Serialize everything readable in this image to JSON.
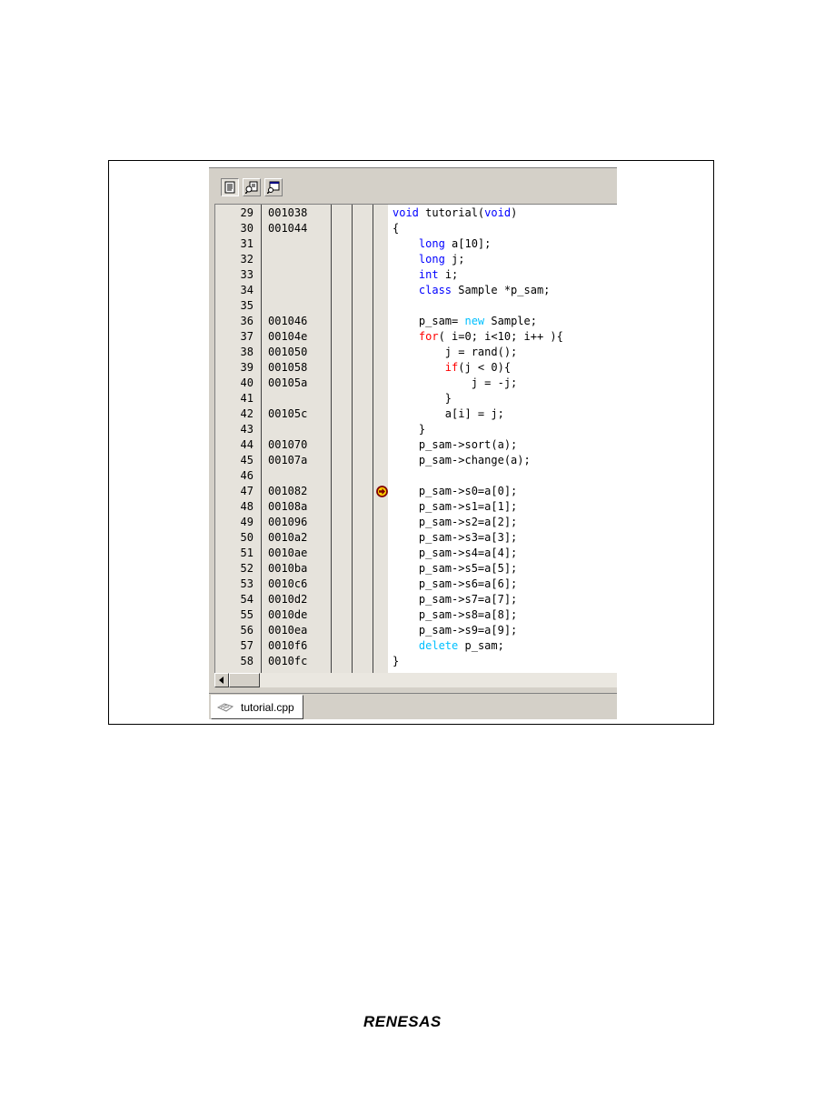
{
  "editor": {
    "toolbar": [
      {
        "icon": "source-view-icon"
      },
      {
        "icon": "mixed-view-icon"
      },
      {
        "icon": "disassembly-view-icon"
      }
    ],
    "lines": [
      {
        "num": "29",
        "addr": "001038",
        "code": [
          {
            "t": "void",
            "c": "kw"
          },
          {
            "t": " tutorial("
          },
          {
            "t": "void",
            "c": "kw"
          },
          {
            "t": ")"
          }
        ]
      },
      {
        "num": "30",
        "addr": "001044",
        "code": [
          {
            "t": "{"
          }
        ]
      },
      {
        "num": "31",
        "addr": "",
        "code": [
          {
            "t": "    "
          },
          {
            "t": "long",
            "c": "kw"
          },
          {
            "t": " a[10];"
          }
        ]
      },
      {
        "num": "32",
        "addr": "",
        "code": [
          {
            "t": "    "
          },
          {
            "t": "long",
            "c": "kw"
          },
          {
            "t": " j;"
          }
        ]
      },
      {
        "num": "33",
        "addr": "",
        "code": [
          {
            "t": "    "
          },
          {
            "t": "int",
            "c": "kw"
          },
          {
            "t": " i;"
          }
        ]
      },
      {
        "num": "34",
        "addr": "",
        "code": [
          {
            "t": "    "
          },
          {
            "t": "class",
            "c": "kw"
          },
          {
            "t": " Sample *p_sam;"
          }
        ]
      },
      {
        "num": "35",
        "addr": "",
        "code": []
      },
      {
        "num": "36",
        "addr": "001046",
        "code": [
          {
            "t": "    p_sam= "
          },
          {
            "t": "new",
            "c": "kc"
          },
          {
            "t": " Sample;"
          }
        ]
      },
      {
        "num": "37",
        "addr": "00104e",
        "code": [
          {
            "t": "    "
          },
          {
            "t": "for",
            "c": "kr"
          },
          {
            "t": "( i=0; i<10; i++ ){"
          }
        ]
      },
      {
        "num": "38",
        "addr": "001050",
        "code": [
          {
            "t": "        j = rand();"
          }
        ]
      },
      {
        "num": "39",
        "addr": "001058",
        "code": [
          {
            "t": "        "
          },
          {
            "t": "if",
            "c": "kr"
          },
          {
            "t": "(j < 0){"
          }
        ]
      },
      {
        "num": "40",
        "addr": "00105a",
        "code": [
          {
            "t": "            j = -j;"
          }
        ]
      },
      {
        "num": "41",
        "addr": "",
        "code": [
          {
            "t": "        }"
          }
        ]
      },
      {
        "num": "42",
        "addr": "00105c",
        "code": [
          {
            "t": "        a[i] = j;"
          }
        ]
      },
      {
        "num": "43",
        "addr": "",
        "code": [
          {
            "t": "    }"
          }
        ]
      },
      {
        "num": "44",
        "addr": "001070",
        "code": [
          {
            "t": "    p_sam->sort(a);"
          }
        ]
      },
      {
        "num": "45",
        "addr": "00107a",
        "code": [
          {
            "t": "    p_sam->change(a);"
          }
        ]
      },
      {
        "num": "46",
        "addr": "",
        "code": []
      },
      {
        "num": "47",
        "addr": "001082",
        "code": [
          {
            "t": "    p_sam->s0=a[0];"
          }
        ],
        "pc": true
      },
      {
        "num": "48",
        "addr": "00108a",
        "code": [
          {
            "t": "    p_sam->s1=a[1];"
          }
        ]
      },
      {
        "num": "49",
        "addr": "001096",
        "code": [
          {
            "t": "    p_sam->s2=a[2];"
          }
        ]
      },
      {
        "num": "50",
        "addr": "0010a2",
        "code": [
          {
            "t": "    p_sam->s3=a[3];"
          }
        ]
      },
      {
        "num": "51",
        "addr": "0010ae",
        "code": [
          {
            "t": "    p_sam->s4=a[4];"
          }
        ]
      },
      {
        "num": "52",
        "addr": "0010ba",
        "code": [
          {
            "t": "    p_sam->s5=a[5];"
          }
        ]
      },
      {
        "num": "53",
        "addr": "0010c6",
        "code": [
          {
            "t": "    p_sam->s6=a[6];"
          }
        ]
      },
      {
        "num": "54",
        "addr": "0010d2",
        "code": [
          {
            "t": "    p_sam->s7=a[7];"
          }
        ]
      },
      {
        "num": "55",
        "addr": "0010de",
        "code": [
          {
            "t": "    p_sam->s8=a[8];"
          }
        ]
      },
      {
        "num": "56",
        "addr": "0010ea",
        "code": [
          {
            "t": "    p_sam->s9=a[9];"
          }
        ]
      },
      {
        "num": "57",
        "addr": "0010f6",
        "code": [
          {
            "t": "    "
          },
          {
            "t": "delete",
            "c": "kc"
          },
          {
            "t": " p_sam;"
          }
        ]
      },
      {
        "num": "58",
        "addr": "0010fc",
        "code": [
          {
            "t": "}"
          }
        ]
      }
    ],
    "tab_label": "tutorial.cpp"
  },
  "footer": {
    "logo": "RENESAS"
  },
  "colors": {
    "keyword": "#0000ff",
    "cyan_keyword": "#00c0ff",
    "control_keyword": "#ff0000",
    "gutter": "#e6e3dc"
  }
}
